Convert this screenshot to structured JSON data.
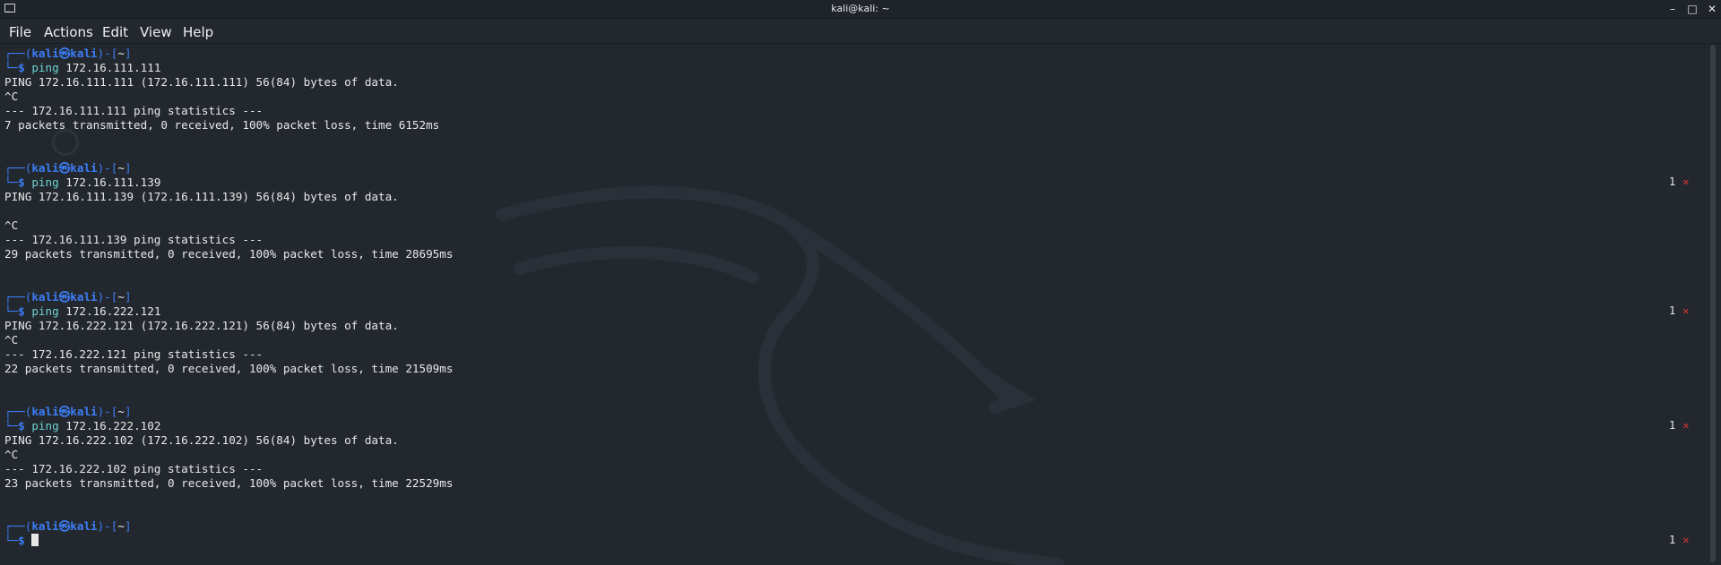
{
  "window": {
    "title": "kali@kali: ~"
  },
  "menu": [
    "File",
    "Actions",
    "Edit",
    "View",
    "Help"
  ],
  "prompt": {
    "user": "kali",
    "host": "kali",
    "dir": "~",
    "symbol": "$"
  },
  "blocks": [
    {
      "command": "ping 172.16.111.111",
      "output": [
        "PING 172.16.111.111 (172.16.111.111) 56(84) bytes of data.",
        "^C",
        "--- 172.16.111.111 ping statistics ---",
        "7 packets transmitted, 0 received, 100% packet loss, time 6152ms"
      ],
      "exit_status": ""
    },
    {
      "command": "ping 172.16.111.139",
      "output": [
        "PING 172.16.111.139 (172.16.111.139) 56(84) bytes of data.",
        "",
        "^C",
        "--- 172.16.111.139 ping statistics ---",
        "29 packets transmitted, 0 received, 100% packet loss, time 28695ms"
      ],
      "exit_status": "1"
    },
    {
      "command": "ping 172.16.222.121",
      "output": [
        "PING 172.16.222.121 (172.16.222.121) 56(84) bytes of data.",
        "^C",
        "--- 172.16.222.121 ping statistics ---",
        "22 packets transmitted, 0 received, 100% packet loss, time 21509ms"
      ],
      "exit_status": "1"
    },
    {
      "command": "ping 172.16.222.102",
      "output": [
        "PING 172.16.222.102 (172.16.222.102) 56(84) bytes of data.",
        "^C",
        "--- 172.16.222.102 ping statistics ---",
        "23 packets transmitted, 0 received, 100% packet loss, time 22529ms"
      ],
      "exit_status": "1"
    }
  ],
  "final_prompt_status": "1",
  "colors": {
    "background": "#23282f",
    "prompt_blue": "#3c7ef7",
    "error_red": "#e0362e"
  }
}
